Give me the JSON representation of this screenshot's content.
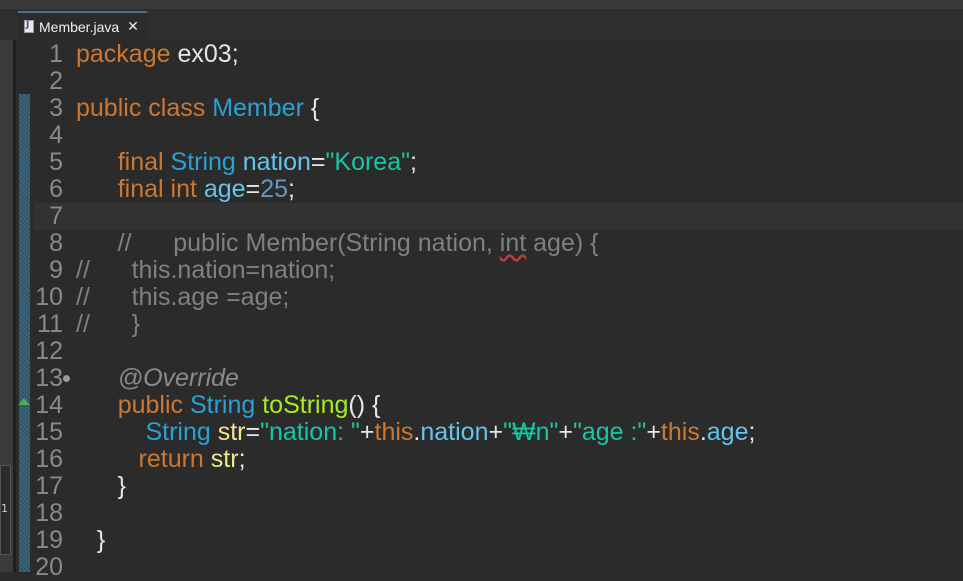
{
  "tab": {
    "label": "Member.java",
    "close_glyph": "✕",
    "file_icon": "java-file-icon"
  },
  "side_panel": {
    "label": "1"
  },
  "lines": [
    {
      "n": "1",
      "tokens": [
        [
          "kw",
          "package"
        ],
        [
          "pl",
          " ex03;"
        ]
      ]
    },
    {
      "n": "2",
      "tokens": []
    },
    {
      "n": "3",
      "tokens": [
        [
          "kw",
          "public"
        ],
        [
          "pl",
          " "
        ],
        [
          "kw",
          "class"
        ],
        [
          "pl",
          " "
        ],
        [
          "ty",
          "Member"
        ],
        [
          "pl",
          " {"
        ]
      ]
    },
    {
      "n": "4",
      "tokens": []
    },
    {
      "n": "5",
      "tokens": [
        [
          "pl",
          "      "
        ],
        [
          "kw",
          "final"
        ],
        [
          "pl",
          " "
        ],
        [
          "ty",
          "String"
        ],
        [
          "pl",
          " "
        ],
        [
          "fd",
          "nation"
        ],
        [
          "pl",
          "="
        ],
        [
          "str",
          "\"Korea\""
        ],
        [
          "pl",
          ";"
        ]
      ]
    },
    {
      "n": "6",
      "tokens": [
        [
          "pl",
          "      "
        ],
        [
          "kw",
          "final"
        ],
        [
          "pl",
          " "
        ],
        [
          "kw",
          "int"
        ],
        [
          "pl",
          " "
        ],
        [
          "fd",
          "age"
        ],
        [
          "pl",
          "="
        ],
        [
          "num",
          "25"
        ],
        [
          "pl",
          ";"
        ]
      ]
    },
    {
      "n": "7",
      "tokens": [],
      "current": true
    },
    {
      "n": "8",
      "tokens": [
        [
          "cm",
          "      //      public Member(String nation, "
        ],
        [
          "cm squig",
          "int"
        ],
        [
          "cm",
          " age) {"
        ]
      ]
    },
    {
      "n": "9",
      "tokens": [
        [
          "cm",
          "//      this.nation=nation;"
        ]
      ]
    },
    {
      "n": "10",
      "tokens": [
        [
          "cm",
          "//      this.age =age;"
        ]
      ]
    },
    {
      "n": "11",
      "tokens": [
        [
          "cm",
          "//      }"
        ]
      ]
    },
    {
      "n": "12",
      "tokens": []
    },
    {
      "n": "13",
      "tokens": [
        [
          "pl",
          "      "
        ],
        [
          "an",
          "@Override"
        ]
      ],
      "fold": true
    },
    {
      "n": "14",
      "tokens": [
        [
          "pl",
          "      "
        ],
        [
          "kw",
          "public"
        ],
        [
          "pl",
          " "
        ],
        [
          "ty",
          "String"
        ],
        [
          "pl",
          " "
        ],
        [
          "fn",
          "toString"
        ],
        [
          "pl",
          "() {"
        ]
      ]
    },
    {
      "n": "15",
      "tokens": [
        [
          "pl",
          "          "
        ],
        [
          "ty",
          "String"
        ],
        [
          "pl",
          " "
        ],
        [
          "loc",
          "str"
        ],
        [
          "pl",
          "="
        ],
        [
          "str",
          "\"nation: \""
        ],
        [
          "pl",
          "+"
        ],
        [
          "kw",
          "this"
        ],
        [
          "pl",
          "."
        ],
        [
          "fd",
          "nation"
        ],
        [
          "pl",
          "+"
        ],
        [
          "str",
          "\"₩n\""
        ],
        [
          "pl",
          "+"
        ],
        [
          "str",
          "\"age :\""
        ],
        [
          "pl",
          "+"
        ],
        [
          "kw",
          "this"
        ],
        [
          "pl",
          "."
        ],
        [
          "fd",
          "age"
        ],
        [
          "pl",
          ";"
        ]
      ]
    },
    {
      "n": "16",
      "tokens": [
        [
          "pl",
          "         "
        ],
        [
          "kw",
          "return"
        ],
        [
          "pl",
          " "
        ],
        [
          "loc",
          "str"
        ],
        [
          "pl",
          ";"
        ]
      ]
    },
    {
      "n": "17",
      "tokens": [
        [
          "pl",
          "      }"
        ]
      ]
    },
    {
      "n": "18",
      "tokens": []
    },
    {
      "n": "19",
      "tokens": [
        [
          "pl",
          "   }"
        ]
      ]
    },
    {
      "n": "20",
      "tokens": []
    }
  ],
  "colors": {
    "keyword": "#cc7832",
    "type": "#2aa1d3",
    "field": "#63c5ea",
    "string": "#17c6a3",
    "comment": "#808080"
  }
}
